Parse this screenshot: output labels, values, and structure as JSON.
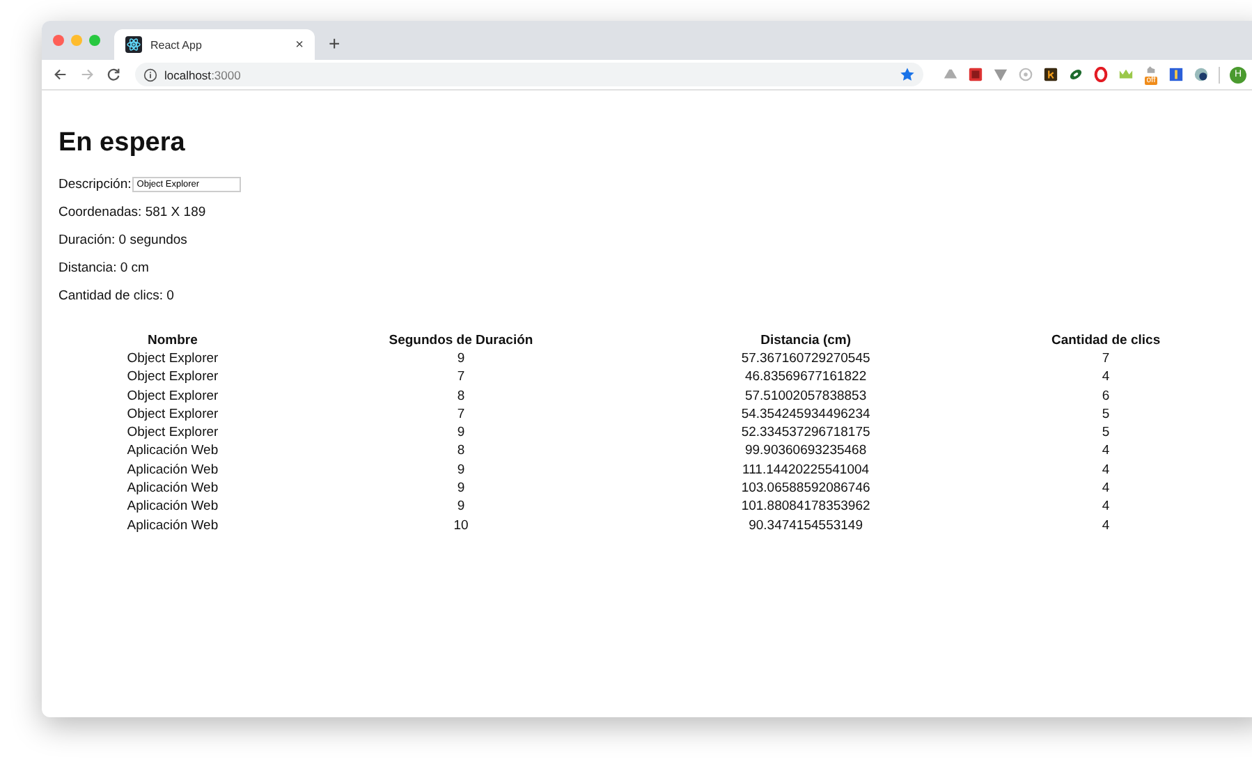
{
  "browser": {
    "tab": {
      "title": "React App",
      "close": "×"
    },
    "new_tab": "+",
    "address": {
      "host": "localhost",
      "port": ":3000"
    },
    "extension_badge": "off",
    "profile": "H"
  },
  "page": {
    "heading": "En espera",
    "description": {
      "label": "Descripción:",
      "value": "Object Explorer"
    },
    "lines": [
      "Coordenadas: 581 X 189",
      "Duración: 0 segundos",
      "Distancia: 0 cm",
      "Cantidad de clics: 0"
    ],
    "table": {
      "columns": [
        "Nombre",
        "Segundos de Duración",
        "Distancia (cm)",
        "Cantidad de clics"
      ],
      "rows": [
        [
          "Object Explorer",
          "9",
          "57.367160729270545",
          "7"
        ],
        [
          "Object Explorer",
          "7",
          "46.83569677161822",
          "4"
        ],
        [
          "Object Explorer",
          "8",
          "57.51002057838853",
          "6"
        ],
        [
          "Object Explorer",
          "7",
          "54.354245934496234",
          "5"
        ],
        [
          "Object Explorer",
          "9",
          "52.334537296718175",
          "5"
        ],
        [
          "Aplicación Web",
          "8",
          "99.90360693235468",
          "4"
        ],
        [
          "Aplicación Web",
          "9",
          "111.14420225541004",
          "4"
        ],
        [
          "Aplicación Web",
          "9",
          "103.06588592086746",
          "4"
        ],
        [
          "Aplicación Web",
          "9",
          "101.88084178353962",
          "4"
        ],
        [
          "Aplicación Web",
          "10",
          "90.3474154553149",
          "4"
        ]
      ]
    }
  }
}
